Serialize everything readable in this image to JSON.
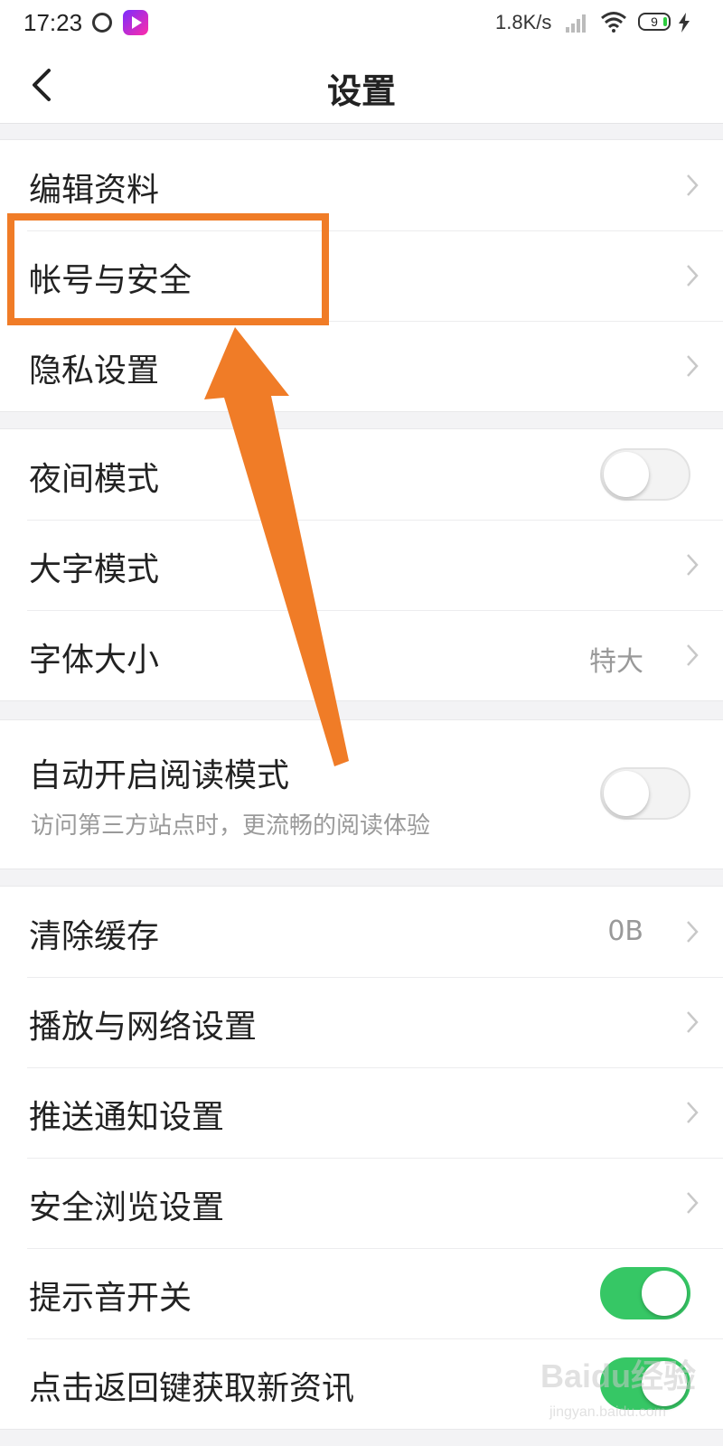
{
  "status_bar": {
    "time": "17:23",
    "net_speed": "1.8K/s",
    "battery_level": "9"
  },
  "header": {
    "title": "设置"
  },
  "groups": [
    {
      "items": [
        {
          "label": "编辑资料",
          "type": "nav"
        },
        {
          "label": "帐号与安全",
          "type": "nav"
        },
        {
          "label": "隐私设置",
          "type": "nav"
        }
      ]
    },
    {
      "items": [
        {
          "label": "夜间模式",
          "type": "toggle",
          "on": false
        },
        {
          "label": "大字模式",
          "type": "nav"
        },
        {
          "label": "字体大小",
          "type": "nav",
          "value": "特大"
        }
      ]
    },
    {
      "items": [
        {
          "label": "自动开启阅读模式",
          "type": "toggle",
          "on": false,
          "subtitle": "访问第三方站点时，更流畅的阅读体验"
        }
      ]
    },
    {
      "items": [
        {
          "label": "清除缓存",
          "type": "nav",
          "value": "0B"
        },
        {
          "label": "播放与网络设置",
          "type": "nav"
        },
        {
          "label": "推送通知设置",
          "type": "nav"
        },
        {
          "label": "安全浏览设置",
          "type": "nav"
        },
        {
          "label": "提示音开关",
          "type": "toggle",
          "on": true
        },
        {
          "label": "点击返回键获取新资讯",
          "type": "toggle",
          "on": true
        }
      ]
    }
  ],
  "colors": {
    "accent_green": "#36c765",
    "annotation_orange": "#f07c27"
  },
  "watermark": {
    "text": "Baidu经验",
    "sub": "jingyan.baidu.com"
  }
}
